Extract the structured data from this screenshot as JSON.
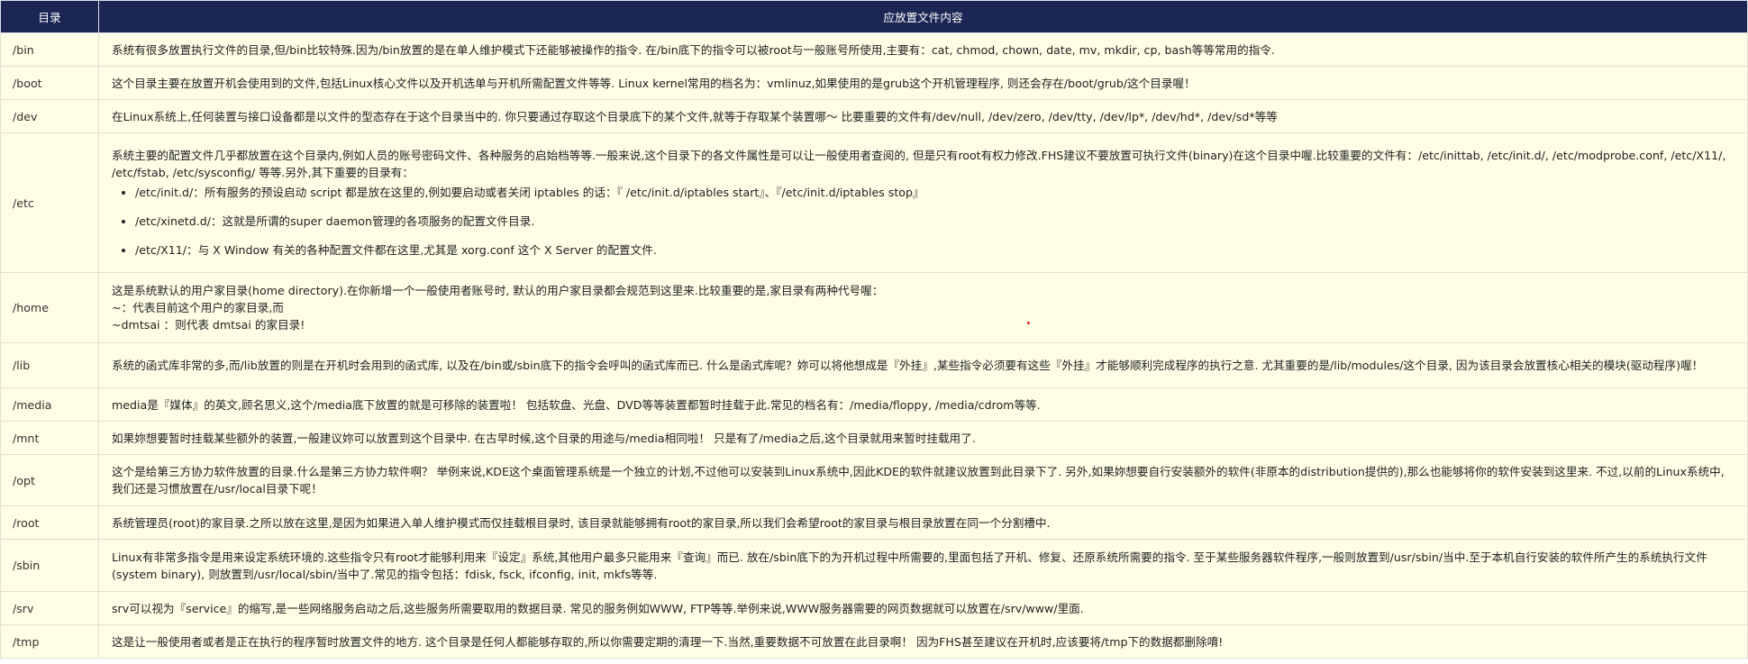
{
  "header": {
    "col_dir": "目录",
    "col_content": "应放置文件内容"
  },
  "rows": [
    {
      "dir": "/bin",
      "lines": [
        "系统有很多放置执行文件的目录,但/bin比较特殊.因为/bin放置的是在单人维护模式下还能够被操作的指令. 在/bin底下的指令可以被root与一般账号所使用,主要有：cat, chmod, chown, date, mv, mkdir, cp, bash等等常用的指令."
      ]
    },
    {
      "dir": "/boot",
      "lines": [
        "这个目录主要在放置开机会使用到的文件,包括Linux核心文件以及开机选单与开机所需配置文件等等. Linux kernel常用的档名为：vmlinuz,如果使用的是grub这个开机管理程序, 则还会存在/boot/grub/这个目录喔！"
      ]
    },
    {
      "dir": "/dev",
      "lines": [
        "在Linux系统上,任何装置与接口设备都是以文件的型态存在于这个目录当中的. 你只要通过存取这个目录底下的某个文件,就等于存取某个装置哪～ 比要重要的文件有/dev/null, /dev/zero, /dev/tty, /dev/lp*, /dev/hd*, /dev/sd*等等"
      ]
    },
    {
      "dir": "/etc",
      "lines": [
        "系统主要的配置文件几乎都放置在这个目录内,例如人员的账号密码文件、各种服务的启始档等等.一般来说,这个目录下的各文件属性是可以让一般使用者查阅的, 但是只有root有权力修改.FHS建议不要放置可执行文件(binary)在这个目录中喔.比较重要的文件有：/etc/inittab, /etc/init.d/, /etc/modprobe.conf, /etc/X11/, /etc/fstab, /etc/sysconfig/ 等等.另外,其下重要的目录有："
      ],
      "bullets": [
        "/etc/init.d/：所有服务的预设启动 script 都是放在这里的,例如要启动或者关闭 iptables 的话：『 /etc/init.d/iptables start』、『/etc/init.d/iptables stop』",
        "/etc/xinetd.d/：这就是所谓的super daemon管理的各项服务的配置文件目录.",
        "/etc/X11/：与 X Window 有关的各种配置文件都在这里,尤其是 xorg.conf 这个 X Server 的配置文件."
      ]
    },
    {
      "dir": "/home",
      "lines": [
        "这是系统默认的用户家目录(home directory).在你新增一个一般使用者账号时, 默认的用户家目录都会规范到这里来.比较重要的是,家目录有两种代号喔：",
        "~：代表目前这个用户的家目录,而",
        "~dmtsai ：则代表 dmtsai 的家目录!"
      ]
    },
    {
      "dir": "/lib",
      "lines": [
        "系统的函式库非常的多,而/lib放置的则是在开机时会用到的函式库, 以及在/bin或/sbin底下的指令会呼叫的函式库而已. 什么是函式库呢？妳可以将他想成是『外挂』,某些指令必须要有这些『外挂』才能够顺利完成程序的执行之意. 尤其重要的是/lib/modules/这个目录, 因为该目录会放置核心相关的模块(驱动程序)喔！"
      ]
    },
    {
      "dir": "/media",
      "lines": [
        "media是『媒体』的英文,顾名思义,这个/media底下放置的就是可移除的装置啦！ 包括软盘、光盘、DVD等等装置都暂时挂载于此.常见的档名有：/media/floppy, /media/cdrom等等."
      ]
    },
    {
      "dir": "/mnt",
      "lines": [
        "如果妳想要暂时挂载某些额外的装置,一般建议妳可以放置到这个目录中. 在古早时候,这个目录的用途与/media相同啦！ 只是有了/media之后,这个目录就用来暂时挂载用了."
      ]
    },
    {
      "dir": "/opt",
      "lines": [
        "这个是给第三方协力软件放置的目录.什么是第三方协力软件啊？ 举例来说,KDE这个桌面管理系统是一个独立的计划,不过他可以安装到Linux系统中,因此KDE的软件就建议放置到此目录下了. 另外,如果妳想要自行安装额外的软件(非原本的distribution提供的),那么也能够将你的软件安装到这里来. 不过,以前的Linux系统中,我们还是习惯放置在/usr/local目录下呢！"
      ]
    },
    {
      "dir": "/root",
      "lines": [
        "系统管理员(root)的家目录.之所以放在这里,是因为如果进入单人维护模式而仅挂载根目录时, 该目录就能够拥有root的家目录,所以我们会希望root的家目录与根目录放置在同一个分割槽中."
      ]
    },
    {
      "dir": "/sbin",
      "lines": [
        "Linux有非常多指令是用来设定系统环境的.这些指令只有root才能够利用来『设定』系统,其他用户最多只能用来『查询』而已. 放在/sbin底下的为开机过程中所需要的,里面包括了开机、修复、还原系统所需要的指令. 至于某些服务器软件程序,一般则放置到/usr/sbin/当中.至于本机自行安装的软件所产生的系统执行文件(system binary), 则放置到/usr/local/sbin/当中了.常见的指令包括：fdisk, fsck, ifconfig, init, mkfs等等."
      ]
    },
    {
      "dir": "/srv",
      "lines": [
        "srv可以视为『service』的缩写,是一些网络服务启动之后,这些服务所需要取用的数据目录. 常见的服务例如WWW, FTP等等.举例来说,WWW服务器需要的网页数据就可以放置在/srv/www/里面."
      ]
    },
    {
      "dir": "/tmp",
      "lines": [
        "这是让一般使用者或者是正在执行的程序暂时放置文件的地方. 这个目录是任何人都能够存取的,所以你需要定期的清理一下.当然,重要数据不可放置在此目录啊！ 因为FHS甚至建议在开机时,应该要将/tmp下的数据都删除唷!"
      ]
    }
  ]
}
